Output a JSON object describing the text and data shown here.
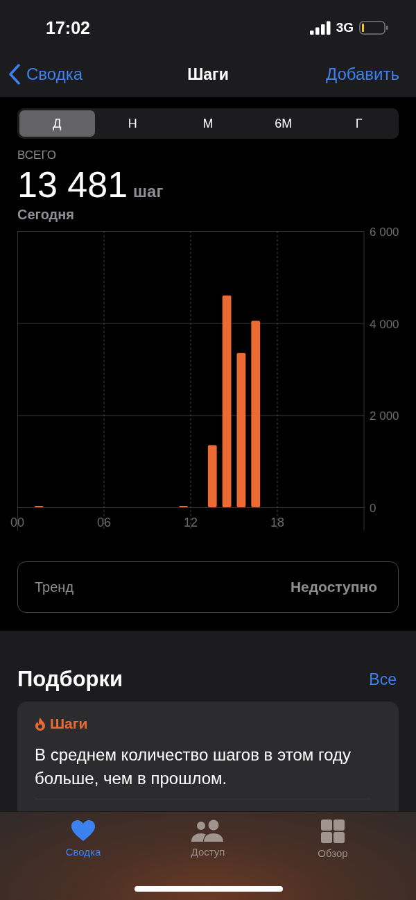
{
  "status_bar": {
    "time": "17:02",
    "network": "3G"
  },
  "nav": {
    "back": "Сводка",
    "title": "Шаги",
    "action": "Добавить"
  },
  "periods": [
    {
      "label": "Д",
      "selected": true
    },
    {
      "label": "Н",
      "selected": false
    },
    {
      "label": "М",
      "selected": false
    },
    {
      "label": "6М",
      "selected": false
    },
    {
      "label": "Г",
      "selected": false
    }
  ],
  "summary": {
    "caption": "ВСЕГО",
    "value": "13 481",
    "unit": "шаг",
    "date": "Сегодня"
  },
  "chart_data": {
    "type": "bar",
    "grid": true,
    "x": [
      1.5,
      11.5,
      13.5,
      14.5,
      15.5,
      16.5
    ],
    "xlim": [
      0,
      24
    ],
    "series": [
      {
        "color": "#ec6a34",
        "values": [
          30,
          30,
          1350,
          4600,
          3350,
          4050
        ]
      }
    ],
    "ylim": [
      0,
      6000
    ],
    "yticks": [
      {
        "value": 0,
        "label": "0"
      },
      {
        "value": 2000,
        "label": "2 000"
      },
      {
        "value": 4000,
        "label": "4 000"
      },
      {
        "value": 6000,
        "label": "6 000"
      }
    ],
    "xticks": [
      {
        "value": 0,
        "label": "00"
      },
      {
        "value": 6,
        "label": "06"
      },
      {
        "value": 12,
        "label": "12"
      },
      {
        "value": 18,
        "label": "18"
      }
    ]
  },
  "trend": {
    "label": "Тренд",
    "value": "Недоступно"
  },
  "highlights": {
    "title": "Подборки",
    "link": "Все",
    "cards": [
      {
        "category": "Шаги",
        "text": "В среднем количество шагов в этом году больше, чем в прошлом."
      }
    ]
  },
  "tab_bar": [
    {
      "label": "Сводка",
      "kind": "heart",
      "selected": true
    },
    {
      "label": "Доступ",
      "kind": "people",
      "selected": false
    },
    {
      "label": "Обзор",
      "kind": "grid",
      "selected": false
    }
  ]
}
